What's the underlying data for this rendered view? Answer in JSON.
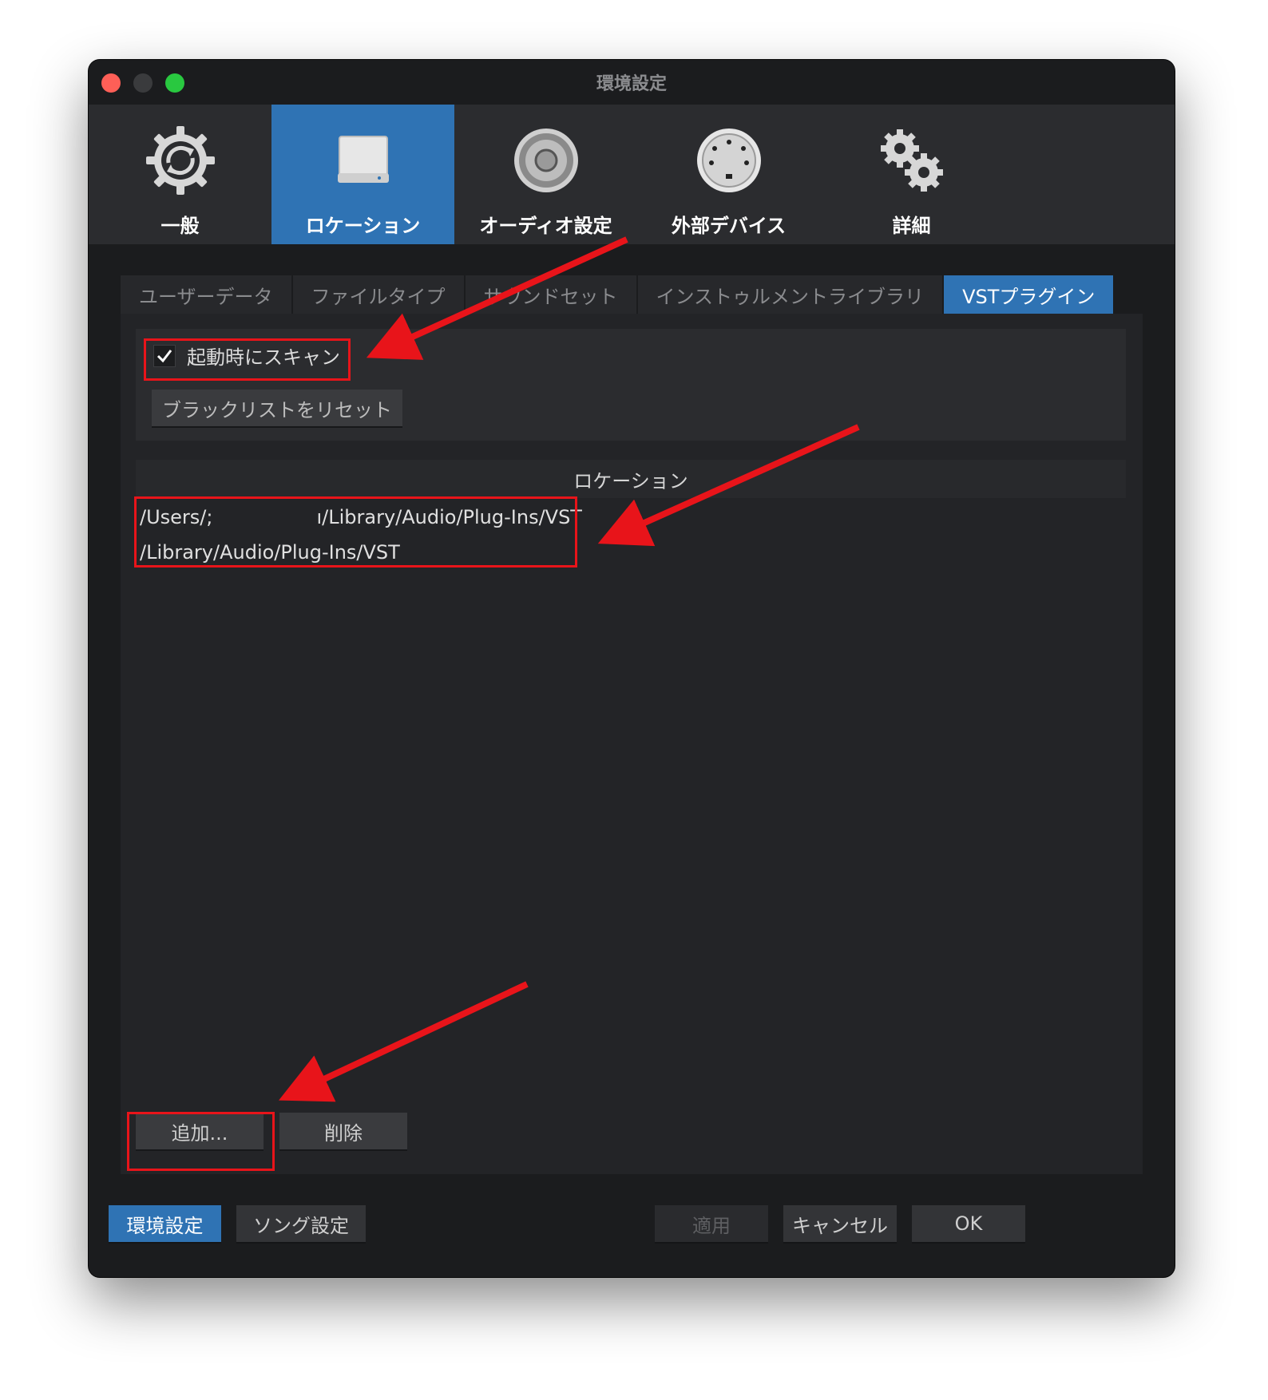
{
  "window": {
    "title": "環境設定"
  },
  "categories": [
    {
      "label": "一般",
      "icon": "sync-gear-icon",
      "active": false
    },
    {
      "label": "ロケーション",
      "icon": "drive-icon",
      "active": true
    },
    {
      "label": "オーディオ設定",
      "icon": "speaker-icon",
      "active": false
    },
    {
      "label": "外部デバイス",
      "icon": "midi-port-icon",
      "active": false
    },
    {
      "label": "詳細",
      "icon": "gears-icon",
      "active": false
    }
  ],
  "tabs": [
    {
      "label": "ユーザーデータ",
      "active": false
    },
    {
      "label": "ファイルタイプ",
      "active": false
    },
    {
      "label": "サウンドセット",
      "active": false
    },
    {
      "label": "インストゥルメントライブラリ",
      "active": false
    },
    {
      "label": "VSTプラグイン",
      "active": true
    }
  ],
  "vst": {
    "scan_label": "起動時にスキャン",
    "scan_checked": true,
    "reset_label": "ブラックリストをリセット",
    "locations_header": "ロケーション",
    "paths": [
      {
        "prefix": "/Users/;",
        "suffix": "ı/Library/Audio/Plug-Ins/VST"
      },
      {
        "prefix": "/Library/Audio/Plug-Ins/VST",
        "suffix": ""
      }
    ],
    "add_label": "追加...",
    "remove_label": "削除"
  },
  "footer": {
    "preferences_label": "環境設定",
    "song_settings_label": "ソング設定",
    "apply_label": "適用",
    "cancel_label": "キャンセル",
    "ok_label": "OK"
  },
  "colors": {
    "accent": "#2f73b4",
    "annotation": "#e8141a"
  }
}
